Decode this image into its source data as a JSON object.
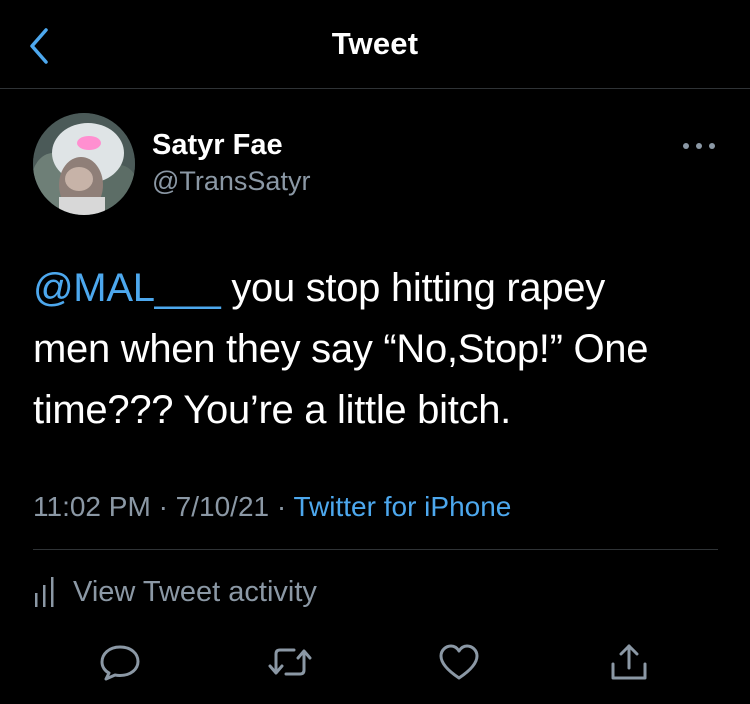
{
  "header": {
    "title": "Tweet",
    "back_icon": "chevron-left-icon"
  },
  "tweet": {
    "author": {
      "display_name": "Satyr Fae",
      "handle": "@TransSatyr"
    },
    "mention": "@MAL___",
    "body_line1": " you stop hitting rapey",
    "body_line2": "men when they say “No,Stop!” One",
    "body_line3": "time??? You’re a little bitch.",
    "time": "11:02 PM",
    "separator": "·",
    "date": "7/10/21",
    "source": "Twitter for iPhone"
  },
  "activity": {
    "label": "View Tweet activity",
    "icon": "bar-chart-icon"
  },
  "actions": [
    {
      "name": "reply",
      "icon": "comment-icon"
    },
    {
      "name": "retweet",
      "icon": "retweet-icon"
    },
    {
      "name": "like",
      "icon": "heart-icon"
    },
    {
      "name": "share",
      "icon": "share-icon"
    }
  ],
  "colors": {
    "background": "#000000",
    "text": "#ffffff",
    "secondary": "#8b98a5",
    "accent": "#4da8ee",
    "divider": "#2f3336"
  }
}
